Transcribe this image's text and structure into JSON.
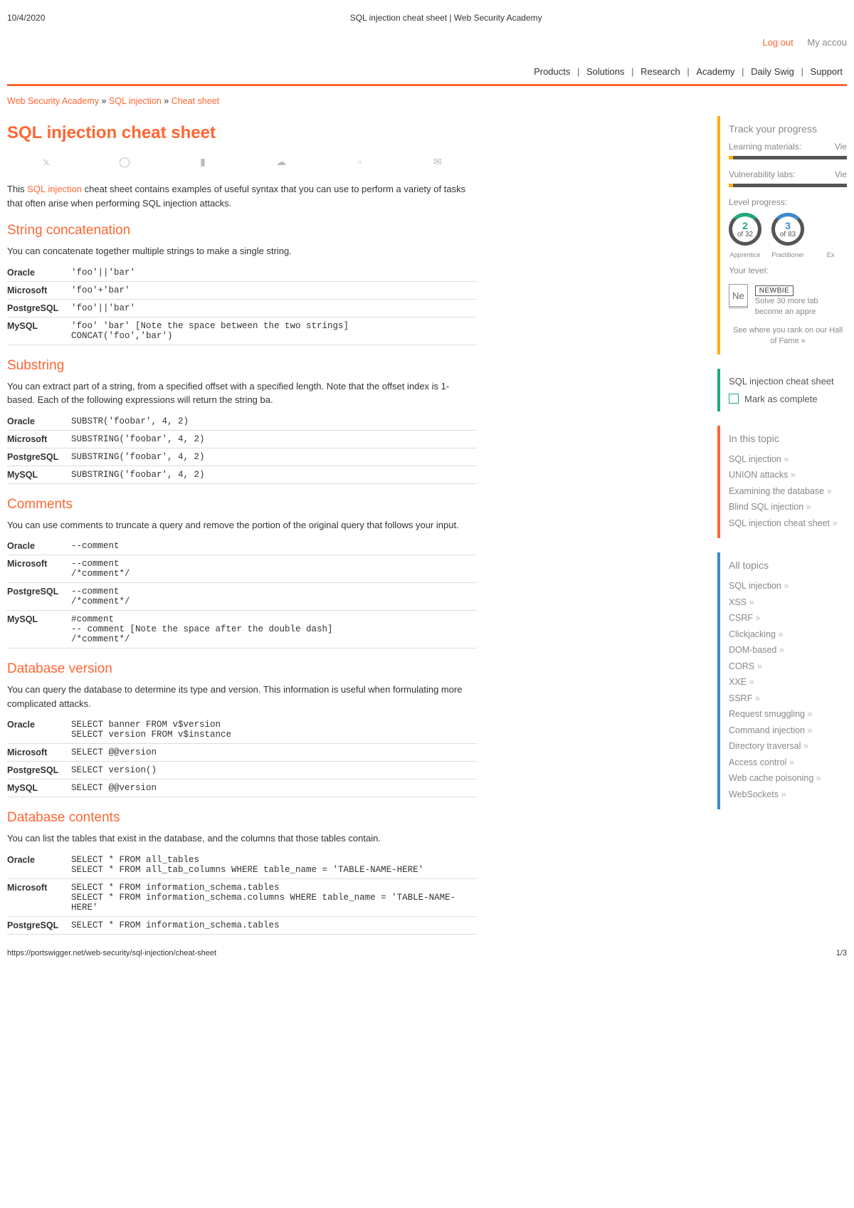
{
  "meta": {
    "date": "10/4/2020",
    "doctitle": "SQL injection cheat sheet | Web Security Academy",
    "url": "https://portswigger.net/web-security/sql-injection/cheat-sheet",
    "page": "1/3"
  },
  "topbar": {
    "logout": "Log out",
    "account": "My accou"
  },
  "nav": [
    "Products",
    "Solutions",
    "Research",
    "Academy",
    "Daily Swig",
    "Support"
  ],
  "breadcrumb": [
    {
      "t": "Web Security Academy"
    },
    {
      "t": "SQL injection"
    },
    {
      "t": "Cheat sheet"
    }
  ],
  "title": "SQL injection cheat sheet",
  "intro_pre": "This ",
  "intro_link": "SQL injection",
  "intro_post": " cheat sheet contains examples of useful syntax that you can use to perform a variety of tasks that often arise when performing SQL injection attacks.",
  "sections": {
    "concat": {
      "h": "String concatenation",
      "p": "You can concatenate together multiple strings to make a single string.",
      "rows": [
        {
          "k": "Oracle",
          "v": "'foo'||'bar'"
        },
        {
          "k": "Microsoft",
          "v": "'foo'+'bar'"
        },
        {
          "k": "PostgreSQL",
          "v": "'foo'||'bar'"
        },
        {
          "k": "MySQL",
          "v": "'foo' 'bar' [Note the space between the two strings]\nCONCAT('foo','bar')"
        }
      ]
    },
    "substr": {
      "h": "Substring",
      "p": "You can extract part of a string, from a specified offset with a specified length. Note that the offset index is 1-based. Each of the following expressions will return the string ba.",
      "rows": [
        {
          "k": "Oracle",
          "v": "SUBSTR('foobar', 4, 2)"
        },
        {
          "k": "Microsoft",
          "v": "SUBSTRING('foobar', 4, 2)"
        },
        {
          "k": "PostgreSQL",
          "v": "SUBSTRING('foobar', 4, 2)"
        },
        {
          "k": "MySQL",
          "v": "SUBSTRING('foobar', 4, 2)"
        }
      ]
    },
    "comments": {
      "h": "Comments",
      "p": "You can use comments to truncate a query and remove the portion of the original query that follows your input.",
      "rows": [
        {
          "k": "Oracle",
          "v": "--comment"
        },
        {
          "k": "Microsoft",
          "v": "--comment\n/*comment*/"
        },
        {
          "k": "PostgreSQL",
          "v": "--comment\n/*comment*/"
        },
        {
          "k": "MySQL",
          "v": "#comment\n-- comment [Note the space after the double dash]\n/*comment*/"
        }
      ]
    },
    "version": {
      "h": "Database version",
      "p": "You can query the database to determine its type and version. This information is useful when formulating more complicated attacks.",
      "rows": [
        {
          "k": "Oracle",
          "v": "SELECT banner FROM v$version\nSELECT version FROM v$instance"
        },
        {
          "k": "Microsoft",
          "v": "SELECT @@version"
        },
        {
          "k": "PostgreSQL",
          "v": "SELECT version()"
        },
        {
          "k": "MySQL",
          "v": "SELECT @@version"
        }
      ]
    },
    "contents": {
      "h": "Database contents",
      "p": "You can list the tables that exist in the database, and the columns that those tables contain.",
      "rows": [
        {
          "k": "Oracle",
          "v": "SELECT * FROM all_tables\nSELECT * FROM all_tab_columns WHERE table_name = 'TABLE-NAME-HERE'"
        },
        {
          "k": "Microsoft",
          "v": "SELECT * FROM information_schema.tables\nSELECT * FROM information_schema.columns WHERE table_name = 'TABLE-NAME-HERE'"
        },
        {
          "k": "PostgreSQL",
          "v": "SELECT * FROM information_schema.tables"
        }
      ]
    }
  },
  "progress": {
    "h": "Track your progress",
    "lm": "Learning materials:",
    "lmv": "Vie",
    "vl": "Vulnerability labs:",
    "vlv": "Vie",
    "lp": "Level progress:",
    "r1n": "2",
    "r1d": "of 32",
    "r1l": "Apprentice",
    "r2n": "3",
    "r2d": "of 83",
    "r2l": "Practitioner",
    "r3l": "Ex",
    "yl": "Your level:",
    "ne": "Ne",
    "badge": "NEWBIE",
    "solve": "Solve 30 more lab become an appre",
    "rank": "See where you rank on our Hall of Fame »"
  },
  "mark": {
    "t": "SQL injection cheat sheet",
    "c": "Mark as complete"
  },
  "inthis": {
    "h": "In this topic",
    "items": [
      "SQL injection",
      "UNION attacks",
      "Examining the database",
      "Blind SQL injection",
      "SQL injection cheat sheet"
    ]
  },
  "alltopics": {
    "h": "All topics",
    "items": [
      "SQL injection",
      "XSS",
      "CSRF",
      "Clickjacking",
      "DOM-based",
      "CORS",
      "XXE",
      "SSRF",
      "Request smuggling",
      "Command injection",
      "Directory traversal",
      "Access control",
      "Web cache poisoning",
      "WebSockets"
    ]
  }
}
